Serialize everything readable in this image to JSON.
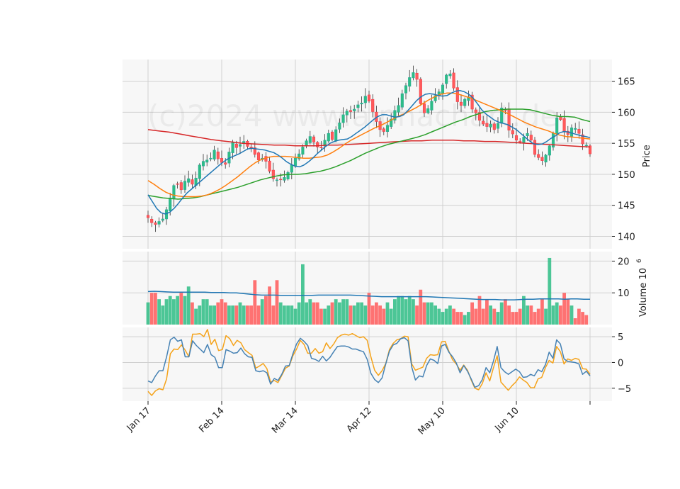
{
  "watermark": "(c)2024 www.alphachart.de",
  "colors": {
    "up": "#26a69a",
    "up_fill": "#2ebd85",
    "down": "#f23645",
    "down_fill": "#ff5b5b",
    "ma_fast": "#1f77b4",
    "ma_mid": "#ff7f0e",
    "ma_slow": "#2ca02c",
    "ma_long": "#d62728",
    "vol_ma": "#1f77b4",
    "osc_a": "#4682b4",
    "osc_b": "#f5a31a",
    "panel_bg": "#f7f7f7",
    "grid": "#d0d0d0"
  },
  "chart_data": {
    "type": "candlestick",
    "x_tick_labels": [
      "Jan 17",
      "Feb 14",
      "Mar 14",
      "Apr 12",
      "May 10",
      "Jun 10",
      ""
    ],
    "x_tick_index": [
      0,
      20,
      40,
      60,
      80,
      100,
      120
    ],
    "price_panel": {
      "ylabel": "Price",
      "ylim": [
        138,
        168.5
      ],
      "yticks": [
        140,
        145,
        150,
        155,
        160,
        165
      ],
      "closes": [
        143,
        142.2,
        141.9,
        142.4,
        142.8,
        144.3,
        146.2,
        148.2,
        148.4,
        147.5,
        148.9,
        149.3,
        148.4,
        149.4,
        151.5,
        152.1,
        152.3,
        152.6,
        153.9,
        152.5,
        151.9,
        151.6,
        153.6,
        155.1,
        154.3,
        154.8,
        155.3,
        154.5,
        154.2,
        153.2,
        152.3,
        152.6,
        152.1,
        150.5,
        149.3,
        149.1,
        149.2,
        149.5,
        150.3,
        151.5,
        152.6,
        153.3,
        154.4,
        155.4,
        156.1,
        155.2,
        154.4,
        154.3,
        155.5,
        156.6,
        155.6,
        157.2,
        158.3,
        159.6,
        160.2,
        160.1,
        160.5,
        161.2,
        161.5,
        162.6,
        161.8,
        160.1,
        158.5,
        157.2,
        156.9,
        157.9,
        158.9,
        160.3,
        161.1,
        163,
        164.3,
        165.6,
        166.4,
        165.3,
        161.4,
        159.9,
        160.6,
        161.8,
        162.7,
        163.3,
        164.4,
        166,
        166.2,
        163.9,
        161.7,
        161.1,
        162.1,
        162.5,
        160.5,
        159.9,
        158.7,
        158.1,
        157.7,
        158.1,
        157.2,
        158.2,
        160.7,
        160.3,
        157.1,
        156.5,
        155.5,
        155.2,
        156,
        156.6,
        155.5,
        153.2,
        152.7,
        152.2,
        153.1,
        154.6,
        156.6,
        159.1,
        158.8,
        156.8,
        156.4,
        157.5,
        157.4,
        156.6,
        154.9,
        154.7,
        153.3
      ],
      "ma_fast": [
        146.7,
        145.6,
        144.5,
        143.8,
        143.6,
        143.9,
        144.5,
        145.3,
        146.2,
        147,
        147.6,
        148.2,
        148.8,
        149.4,
        150,
        150.6,
        151.2,
        151.8,
        152.3,
        152.7,
        153,
        153.3,
        153.7,
        154.1,
        154.2,
        154.1,
        154,
        153.9,
        153.7,
        153.5,
        153.1,
        152.6,
        152,
        151.6,
        151.3,
        151.2,
        151.5,
        152,
        152.6,
        153.3,
        153.9,
        154.5,
        155,
        155.3,
        155.5,
        155.6,
        155.7,
        156.1,
        156.6,
        157.1,
        157.6,
        158.2,
        158.8,
        159.3,
        159.6,
        159.6,
        159.4,
        159.2,
        159.3,
        159.6,
        160.3,
        161.1,
        161.9,
        162.5,
        162.9,
        163,
        162.9,
        162.7,
        162.6,
        162.7,
        163.1,
        163.4,
        163.5,
        163.3,
        162.9,
        162.3,
        161.4,
        160.4,
        159.7,
        159.2,
        158.7,
        158.4,
        158.2,
        158,
        157.6,
        157.2,
        156.6,
        156,
        155.4,
        154.9,
        154.8,
        154.9,
        155.3,
        155.8,
        156.2,
        156.7,
        156.9,
        156.8,
        156.6,
        156.4,
        156.2,
        156.1,
        155.9
      ],
      "ma_mid": [
        149,
        148.4,
        147.7,
        147.1,
        146.7,
        146.5,
        146.4,
        146.4,
        146.4,
        146.5,
        146.7,
        147.1,
        147.6,
        148.2,
        148.9,
        149.6,
        150.4,
        151.2,
        151.9,
        152.4,
        152.7,
        152.9,
        152.9,
        152.9,
        152.8,
        152.7,
        152.6,
        152.6,
        152.7,
        152.8,
        153.1,
        153.6,
        154.2,
        154.9,
        155.5,
        156,
        156.5,
        157,
        157.5,
        157.9,
        158.4,
        158.9,
        159.4,
        159.8,
        160.3,
        160.8,
        161.4,
        162,
        162.5,
        162.9,
        163.1,
        163.1,
        162.9,
        162.6,
        162.3,
        161.9,
        161.5,
        161.1,
        160.7,
        160.3,
        159.9,
        159.4,
        158.9,
        158.4,
        158,
        157.6,
        157.3,
        157,
        156.6,
        156.3,
        156.1,
        156,
        155.9,
        155.8,
        155.7
      ],
      "ma_slow": [
        146.6,
        146.4,
        146.2,
        146.1,
        146,
        146.1,
        146.2,
        146.4,
        146.7,
        147,
        147.3,
        147.6,
        147.9,
        148.3,
        148.7,
        149.1,
        149.4,
        149.7,
        149.9,
        150,
        150,
        150.1,
        150.3,
        150.5,
        150.8,
        151.2,
        151.7,
        152.2,
        152.8,
        153.4,
        153.9,
        154.4,
        154.8,
        155.1,
        155.4,
        155.7,
        156,
        156.4,
        156.9,
        157.4,
        157.9,
        158.4,
        158.8,
        159.3,
        159.7,
        160.1,
        160.3,
        160.4,
        160.5,
        160.5,
        160.5,
        160.4,
        160.1,
        159.8,
        159.5,
        159.3,
        159.3,
        159.2,
        158.8,
        158.5
      ],
      "ma_long": [
        157.2,
        157,
        156.8,
        156.5,
        156.2,
        155.9,
        155.6,
        155.4,
        155.2,
        155,
        154.9,
        154.8,
        154.7,
        154.7,
        154.6,
        154.6,
        154.6,
        154.7,
        154.7,
        154.8,
        154.9,
        155,
        155.1,
        155.2,
        155.3,
        155.4,
        155.4,
        155.5,
        155.5,
        155.5,
        155.4,
        155.4,
        155.3,
        155.3,
        155.2,
        155.1,
        155,
        154.9,
        154.8,
        154.7,
        154.6,
        154.5,
        154.4
      ]
    },
    "volume_panel": {
      "ylabel": "Volume",
      "ylabel_exp": "6",
      "ylim": [
        0,
        23
      ],
      "yticks": [
        10,
        20
      ],
      "values": [
        7,
        10,
        10,
        8,
        6,
        8,
        9,
        8,
        9,
        10,
        9,
        12,
        7,
        5,
        6,
        8,
        8,
        6,
        6,
        7,
        8,
        7,
        6,
        6,
        6,
        7,
        6,
        6,
        6,
        14,
        6,
        8,
        9,
        12,
        6,
        14,
        7,
        6,
        6,
        6,
        5,
        7,
        19,
        7,
        8,
        7,
        7,
        5,
        5,
        6,
        7,
        8,
        7,
        8,
        8,
        6,
        6,
        7,
        7,
        6,
        10,
        6,
        7,
        6,
        5,
        7,
        5,
        8,
        9,
        9,
        8,
        9,
        8,
        6,
        11,
        7,
        7,
        7,
        6,
        5,
        4,
        5,
        6,
        5,
        4,
        4,
        3,
        4,
        7,
        5,
        9,
        5,
        8,
        6,
        5,
        4,
        7,
        8,
        6,
        4,
        4,
        5,
        9,
        6,
        6,
        4,
        5,
        8,
        5,
        21,
        6,
        7,
        6,
        10,
        8,
        6,
        2,
        5,
        4,
        3
      ],
      "ma": [
        10.4,
        10.5,
        10.4,
        10.3,
        10.2,
        10.2,
        10.2,
        10.2,
        10.2,
        10.2,
        10.1,
        10.1,
        10.1,
        10,
        10,
        9.8,
        9.6,
        9.4,
        9.3,
        9.3,
        9.3,
        9.2,
        9.2,
        9.2,
        9.2,
        9.2,
        9.2,
        9.3,
        9.3,
        9.3,
        9.3,
        9.3,
        9.3,
        9.2,
        9.1,
        9,
        8.9,
        8.8,
        8.8,
        8.8,
        8.8,
        8.8,
        8.8,
        8.8,
        8.8,
        8.7,
        8.6,
        8.5,
        8.4,
        8.3,
        8.2,
        8.1,
        8,
        7.9,
        7.9,
        7.9,
        7.8,
        7.8,
        7.8,
        7.9,
        8,
        8,
        8.1,
        8.1,
        8.1,
        8.1,
        8,
        8.1,
        8.1,
        8,
        8
      ]
    },
    "oscillator_panel": {
      "ylim": [
        -7.5,
        6.8
      ],
      "yticks": [
        5,
        0,
        -5
      ],
      "line_a": [
        -3.6,
        -3.9,
        -2.6,
        -1.6,
        -1.6,
        1.1,
        4.4,
        4.9,
        4.1,
        4.4,
        1.1,
        1.1,
        4.2,
        3.3,
        2.6,
        1.9,
        3.5,
        1.5,
        1,
        -1,
        -1,
        2.5,
        2.2,
        1.8,
        1.9,
        2.8,
        1.7,
        1.1,
        1,
        -1.6,
        -1.8,
        -1.6,
        -2,
        -4.2,
        -3.1,
        -3.5,
        -2.3,
        -0.7,
        -0.6,
        1.7,
        3.6,
        4.7,
        4.1,
        3.3,
        0.8,
        0.6,
        0.2,
        1.2,
        0.3,
        1,
        2.1,
        3.1,
        3.2,
        3.2,
        3,
        2.6,
        2.6,
        2.3,
        2.1,
        0.6,
        -2.1,
        -3.3,
        -3.9,
        -3,
        -0.3,
        2.2,
        3.4,
        3.7,
        4.6,
        4.8,
        4.2,
        -0.9,
        -3.4,
        -2.6,
        -2.8,
        -0.6,
        0.7,
        0.4,
        -0.2,
        3.2,
        3.5,
        2,
        1.1,
        -0.1,
        -2,
        -0.6,
        -1.7,
        -3.2,
        -4.8,
        -4.5,
        -3.3,
        -1,
        -2,
        0.3,
        3.1,
        -1,
        -1.8,
        -2.3,
        -1.8,
        -1.3,
        -1.8,
        -2.9,
        -2.8,
        -2.3,
        -2.6,
        -1.4,
        -1.8,
        -0.4,
        2,
        0.8,
        4.4,
        3.6,
        0.7,
        0.2,
        0.1,
        0,
        -0.3,
        -2.3,
        -1.7,
        -2.6
      ],
      "line_b": [
        -5.6,
        -6.4,
        -5.5,
        -5.1,
        -5.3,
        -3.2,
        1.7,
        2.6,
        2.5,
        3.4,
        2.4,
        1.1,
        5.5,
        5.5,
        5.6,
        5,
        6.4,
        3.5,
        4.5,
        2.3,
        2.5,
        5.2,
        4.6,
        3.3,
        4.3,
        3.8,
        2.5,
        1.9,
        1.4,
        -1.1,
        -0.7,
        -0.2,
        -1.2,
        -3.8,
        -3.5,
        -3.9,
        -2.5,
        -1.1,
        -0.7,
        1.3,
        2.6,
        4.3,
        3.5,
        1.8,
        1.8,
        2.7,
        1.8,
        2.1,
        3.8,
        2.7,
        3.6,
        4.8,
        5.3,
        5.5,
        5.3,
        5.6,
        5.2,
        4.8,
        5,
        4.3,
        1.1,
        -1.5,
        -2.5,
        -1.6,
        -0.2,
        2.5,
        3.7,
        4.4,
        4.6,
        5.1,
        5,
        -0.3,
        -1.5,
        -1.2,
        -0.9,
        0.8,
        1.5,
        1.4,
        1.5,
        4,
        4.1,
        2.2,
        0.5,
        -0.3,
        -1.5,
        -0.5,
        -1.5,
        -3.4,
        -5,
        -5.3,
        -4.1,
        -2,
        -3.6,
        -1,
        1.3,
        -3.8,
        -4.6,
        -5.4,
        -4.5,
        -3.8,
        -2.8,
        -3.4,
        -3.9,
        -4.9,
        -4.9,
        -3.2,
        -2.9,
        -1,
        0.4,
        -0.1,
        3.1,
        2.1,
        -0.3,
        0.7,
        0.4,
        0.8,
        0.6,
        -1.2,
        -1.3,
        -2.3
      ]
    }
  }
}
